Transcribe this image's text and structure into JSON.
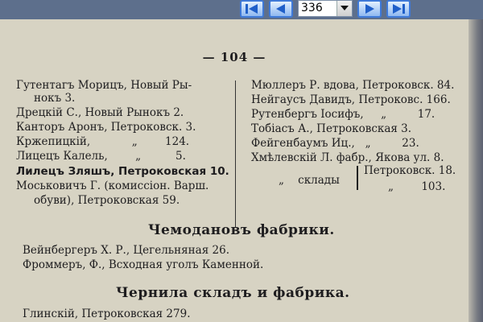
{
  "toolbar": {
    "first_icon": "skip-to-first-icon",
    "prev_icon": "prev-page-icon",
    "page_value": "336",
    "next_icon": "next-page-icon",
    "last_icon": "skip-to-last-icon"
  },
  "page": {
    "number": "— 104 —",
    "left_column": [
      "Гутентагъ Морицъ, Новый Ры-",
      "нокъ 3.",
      "Дрецкій С., Новый Рынокъ 2.",
      "Канторъ Аронъ, Петроковск. 3.",
      "Кржепицкій,            „        124.",
      "Лицецъ Калель,        „          5.",
      "Лилецъ Зляшъ, Петроковская 10.",
      "Моськовичъ Г. (комиссіон. Варш.",
      "обуви), Петроковская 59."
    ],
    "right_column": [
      "Мюллеръ Р. вдова, Петроковск. 84.",
      "Нейгаусъ Давидъ, Петроковс. 166.",
      "Рутенбергъ Іосифъ,     „         17.",
      "Тобіасъ А., Петроковская 3.",
      "Фейгенбаумъ Иц.,   „         23.",
      "Хмѣлевскій Л. фабр., Якова ул. 8.",
      "Петроковск. 18.",
      "„    склады",
      "„        103."
    ],
    "sections": [
      {
        "heading": "Чемодановъ фабрики.",
        "entries": [
          "Вейнбергеръ Х. Р., Цегельняная 26.",
          "Фроммеръ, Ф., Всходная уголъ Каменной."
        ]
      },
      {
        "heading": "Чернила складъ и фабрика.",
        "entries": [
          "Глинскій, Петроковская 279."
        ]
      }
    ]
  }
}
